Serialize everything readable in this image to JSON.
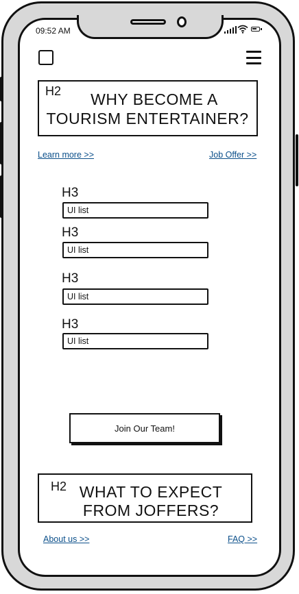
{
  "status_bar": {
    "time": "09:52 AM"
  },
  "hero": {
    "tag": "H2",
    "line1": "WHY BECOME A",
    "line2": "TOURISM ENTERTAINER?"
  },
  "links_top": {
    "left": "Learn more >>",
    "right": "Job Offer >>"
  },
  "sections": [
    {
      "heading": "H3",
      "list": "UI list"
    },
    {
      "heading": "H3",
      "list": "UI list"
    },
    {
      "heading": "H3",
      "list": "UI list"
    },
    {
      "heading": "H3",
      "list": "UI list"
    }
  ],
  "cta": {
    "label": "Join Our Team!"
  },
  "expect": {
    "tag": "H2",
    "line1": "WHAT TO EXPECT",
    "line2": "FROM JOFFERS?"
  },
  "links_bottom": {
    "left": "About us >>",
    "right": "FAQ >>"
  }
}
